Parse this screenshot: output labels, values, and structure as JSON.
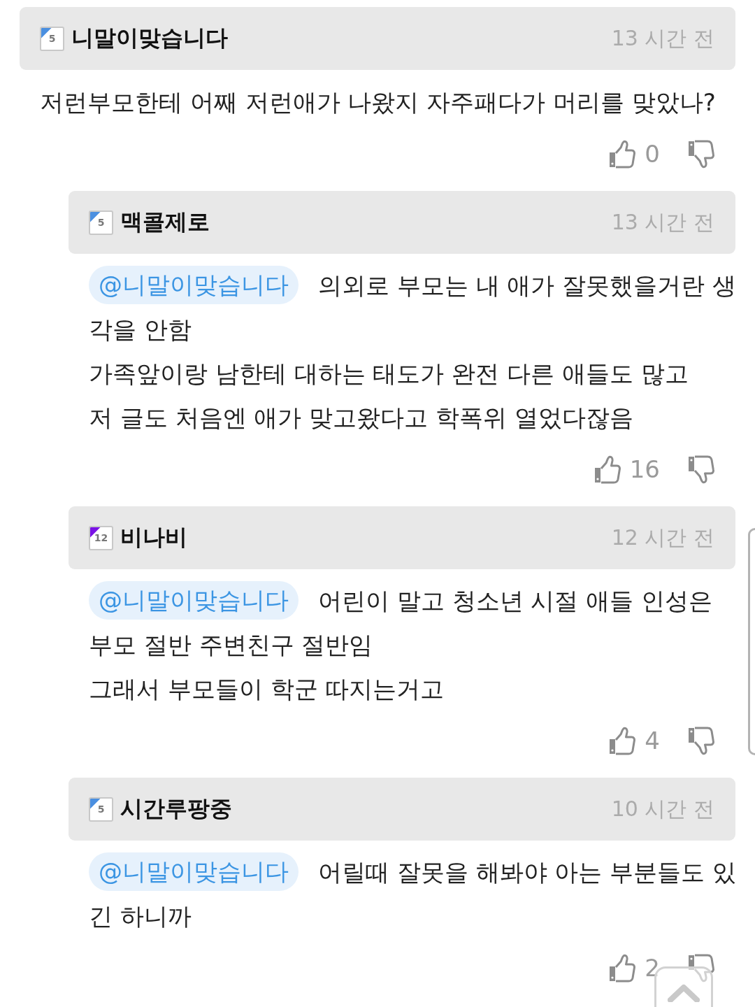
{
  "comments": [
    {
      "author": "니말이맞습니다",
      "level_badge": {
        "number": "5",
        "color": "#4a8fe0"
      },
      "time": "13 시간 전",
      "lines": [
        "저런부모한테 어째 저런애가 나왔지 자주패다가 머리를 맞았나?"
      ],
      "likes": "0",
      "replies": [
        {
          "author": "맥콜제로",
          "level_badge": {
            "number": "5",
            "color": "#4a8fe0"
          },
          "time": "13 시간 전",
          "mention": "@니말이맞습니다",
          "lines": [
            "의외로 부모는 내 애가 잘못했을거란 생",
            "각을 안함",
            "가족앞이랑 남한테 대하는 태도가 완전 다른 애들도 많고",
            "저 글도 처음엔 애가 맞고왔다고 학폭위 열었다잖음"
          ],
          "likes": "16"
        },
        {
          "author": "비나비",
          "level_badge": {
            "number": "12",
            "color": "#7a12e6"
          },
          "time": "12 시간 전",
          "mention": "@니말이맞습니다",
          "lines": [
            "어린이 말고 청소년 시절 애들 인성은",
            "부모 절반 주변친구 절반임",
            "그래서 부모들이 학군 따지는거고"
          ],
          "likes": "4"
        },
        {
          "author": "시간루팡중",
          "level_badge": {
            "number": "5",
            "color": "#4a8fe0"
          },
          "time": "10 시간 전",
          "mention": "@니말이맞습니다",
          "lines": [
            "어릴때 잘못을 해봐야 아는 부분들도 있",
            "긴 하니까"
          ],
          "likes": "2"
        }
      ]
    }
  ]
}
